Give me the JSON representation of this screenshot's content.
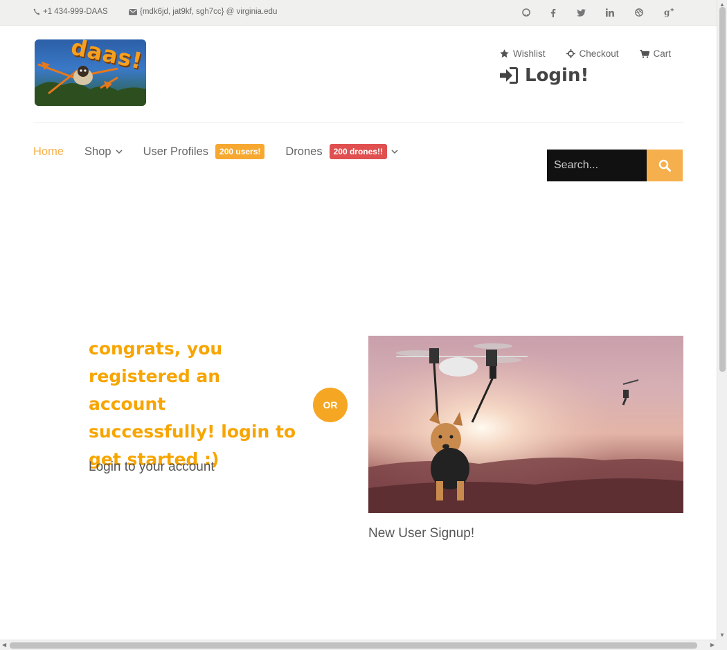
{
  "topbar": {
    "phone": "+1 434-999-DAAS",
    "email": "{mdk6jd, jat9kf, sgh7cc} @ virginia.edu",
    "social_icons": [
      "github-icon",
      "facebook-icon",
      "twitter-icon",
      "linkedin-icon",
      "dribbble-icon",
      "google-plus-icon"
    ]
  },
  "logo": {
    "text": "daas!"
  },
  "header": {
    "wishlist_label": "Wishlist",
    "checkout_label": "Checkout",
    "cart_label": "Cart",
    "login_label": "Login!"
  },
  "nav": {
    "home": "Home",
    "shop": "Shop",
    "user_profiles": "User Profiles",
    "user_badge": "200 users!",
    "drones": "Drones",
    "drones_badge": "200 drones!!"
  },
  "search": {
    "placeholder": "Search..."
  },
  "main": {
    "congrats_message": "congrats, you registered an account successfully! login to get started :)",
    "login_link": "Login to your account",
    "or_label": "OR",
    "signup_link": "New User Signup!"
  },
  "colors": {
    "accent": "#f5b04d",
    "message": "#f7a500",
    "badge_orange": "#f7a830",
    "badge_red": "#e05050"
  }
}
